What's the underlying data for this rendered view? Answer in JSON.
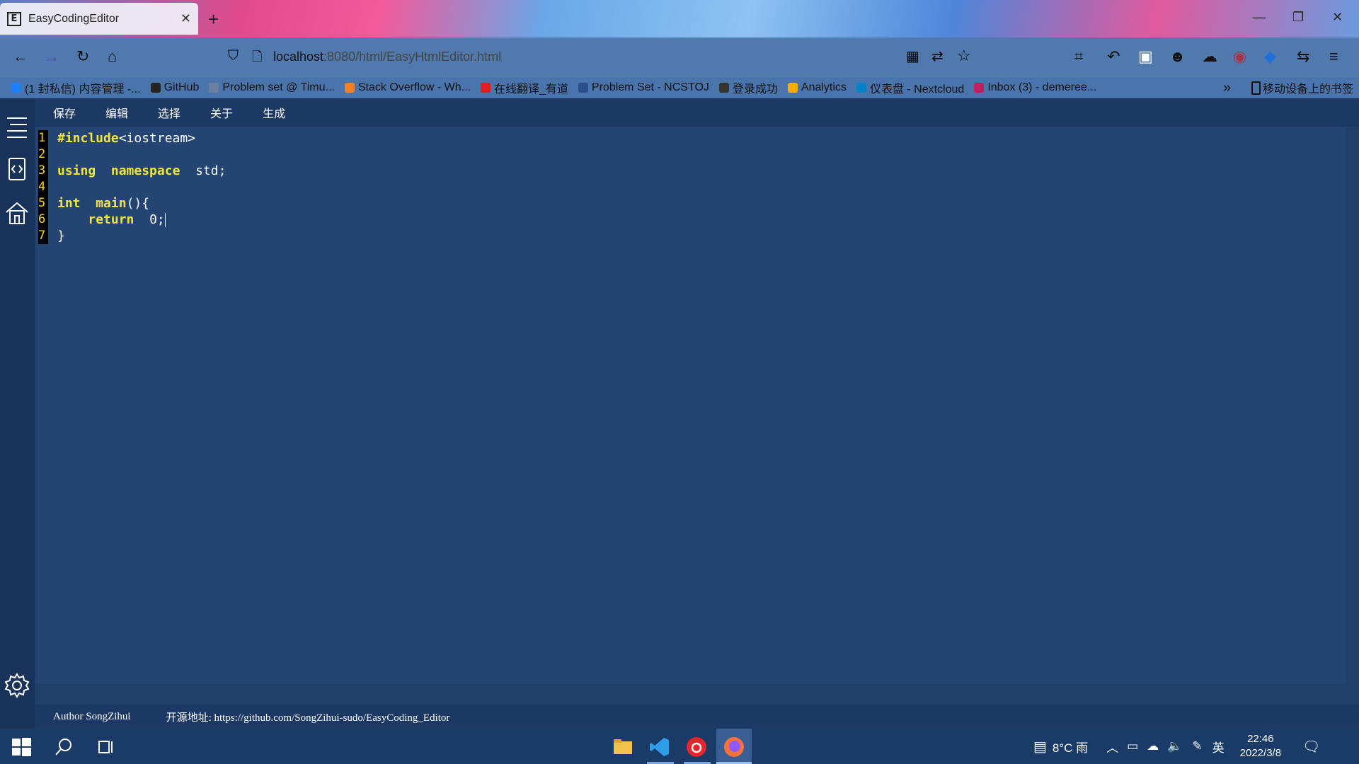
{
  "browser": {
    "tab_title": "EasyCodingEditor",
    "tab_favicon": "E",
    "tab_close": "✕",
    "new_tab": "+",
    "url_host": "localhost",
    "url_path": ":8080/html/EasyHtmlEditor.html",
    "bookmarks": [
      {
        "label": "(1 封私信) 内容管理 -...",
        "color": "#1e80ff"
      },
      {
        "label": "GitHub",
        "color": "#222222"
      },
      {
        "label": "Problem set @ Timu...",
        "color": "#6b7fa0"
      },
      {
        "label": "Stack Overflow - Wh...",
        "color": "#f48024"
      },
      {
        "label": "在线翻译_有道",
        "color": "#e02020"
      },
      {
        "label": "Problem Set - NCSTOJ",
        "color": "#2a4f8a"
      },
      {
        "label": "登录成功",
        "color": "#333333"
      },
      {
        "label": "Analytics",
        "color": "#f9ab00"
      },
      {
        "label": "仪表盘 - Nextcloud",
        "color": "#0082c9"
      },
      {
        "label": "Inbox (3) - demeree...",
        "color": "#c02060"
      }
    ],
    "bookmarks_more": "»",
    "mobile_bookmarks": "移动设备上的书签"
  },
  "menu": [
    "保存",
    "编辑",
    "选择",
    "关于",
    "生成"
  ],
  "editor": {
    "line_numbers": [
      "1",
      "2",
      "3",
      "4",
      "5",
      "6",
      "7"
    ]
  },
  "footer": {
    "author": "Author SongZihui",
    "source": "开源地址: https://github.com/SongZihui-sudo/EasyCoding_Editor"
  },
  "taskbar": {
    "weather": "8°C 雨",
    "ime": "英",
    "time": "22:46",
    "date": "2022/3/8"
  }
}
